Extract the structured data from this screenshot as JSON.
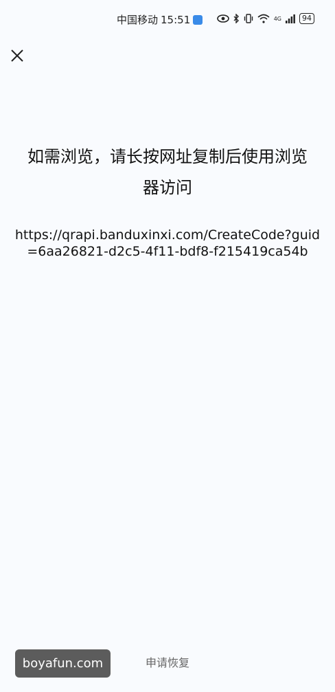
{
  "status_bar": {
    "carrier": "中国移动",
    "time": "15:51",
    "network": "4G",
    "battery": "94"
  },
  "close_button": {
    "icon": "close-icon"
  },
  "main": {
    "title": "如需浏览，请长按网址复制后使用浏览器访问",
    "url": "https://qrapi.banduxinxi.com/CreateCode?guid=6aa26821-d2c5-4f11-bdf8-f215419ca54b"
  },
  "watermark": {
    "text": "boyafun.com"
  },
  "footer": {
    "recover_label": "申请恢复"
  }
}
